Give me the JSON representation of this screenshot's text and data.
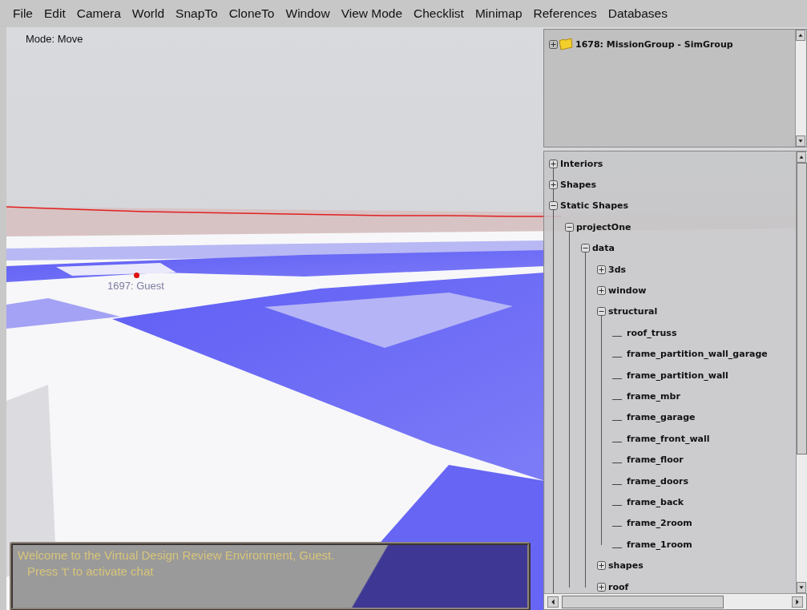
{
  "menu": [
    {
      "label": "File"
    },
    {
      "label": "Edit"
    },
    {
      "label": "Camera"
    },
    {
      "label": "World"
    },
    {
      "label": "SnapTo"
    },
    {
      "label": "CloneTo"
    },
    {
      "label": "Window"
    },
    {
      "label": "View Mode"
    },
    {
      "label": "Checklist"
    },
    {
      "label": "Minimap"
    },
    {
      "label": "References"
    },
    {
      "label": "Databases"
    }
  ],
  "viewport": {
    "mode_label": "Mode: Move",
    "player_label": "1697: Guest"
  },
  "mission_tree": {
    "items": [
      {
        "label": "1678: MissionGroup - SimGroup",
        "expanded": false
      }
    ]
  },
  "object_tree": {
    "items": [
      {
        "label": "Interiors",
        "expanded": false
      },
      {
        "label": "Shapes",
        "expanded": false
      },
      {
        "label": "Static Shapes",
        "expanded": true,
        "children": [
          {
            "label": "projectOne",
            "expanded": true,
            "children": [
              {
                "label": "data",
                "expanded": true,
                "children": [
                  {
                    "label": "3ds",
                    "expanded": false
                  },
                  {
                    "label": "window",
                    "expanded": false
                  },
                  {
                    "label": "structural",
                    "expanded": true,
                    "children": [
                      {
                        "label": "roof_truss"
                      },
                      {
                        "label": "frame_partition_wall_garage"
                      },
                      {
                        "label": "frame_partition_wall"
                      },
                      {
                        "label": "frame_mbr"
                      },
                      {
                        "label": "frame_garage"
                      },
                      {
                        "label": "frame_front_wall"
                      },
                      {
                        "label": "frame_floor"
                      },
                      {
                        "label": "frame_doors"
                      },
                      {
                        "label": "frame_back"
                      },
                      {
                        "label": "frame_2room"
                      },
                      {
                        "label": "frame_1room"
                      }
                    ]
                  },
                  {
                    "label": "shapes",
                    "expanded": false
                  },
                  {
                    "label": "roof",
                    "expanded": false
                  }
                ]
              }
            ]
          }
        ]
      }
    ]
  },
  "chat": {
    "lines": [
      "Welcome to the Virtual Design Review Environment, Guest.",
      "Press 't' to activate chat"
    ]
  }
}
